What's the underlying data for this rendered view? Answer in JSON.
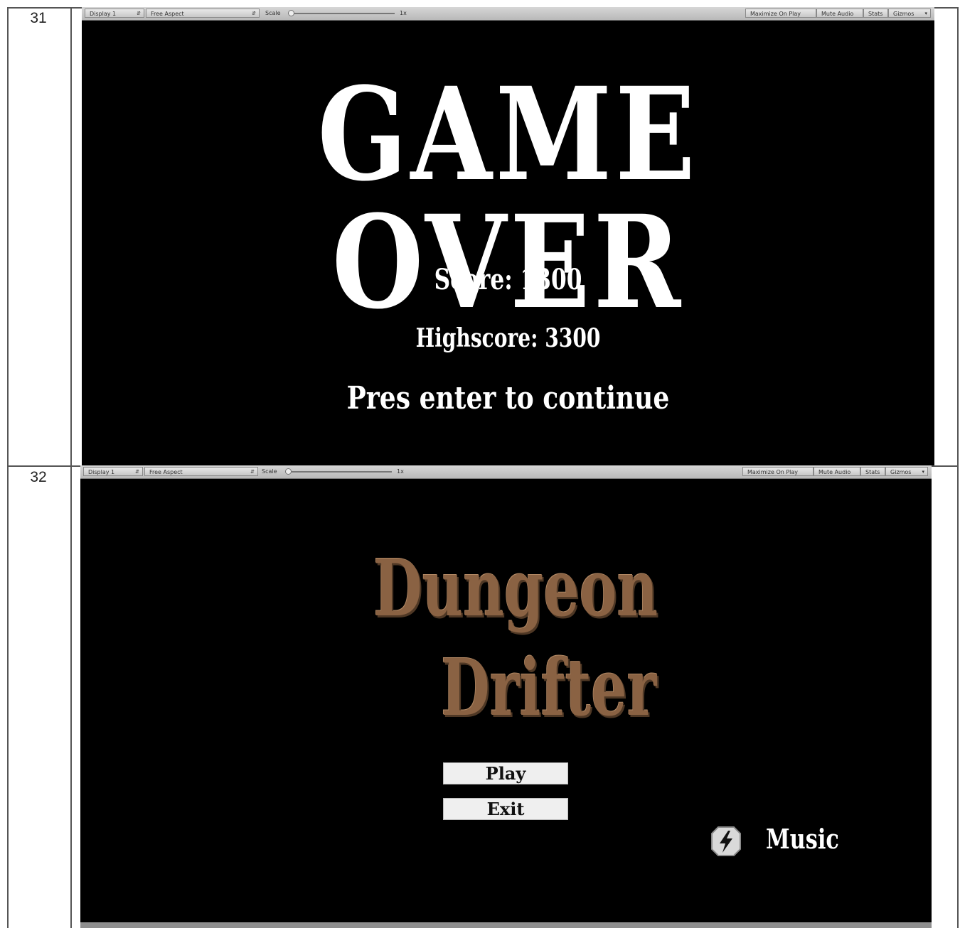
{
  "rows": [
    {
      "number": "31",
      "toolbar": {
        "display": "Display 1",
        "aspect": "Free Aspect",
        "scale_label": "Scale",
        "scale_value": "1x",
        "maximize": "Maximize On Play",
        "mute": "Mute Audio",
        "stats": "Stats",
        "gizmos": "Gizmos"
      },
      "screen": {
        "title": "GAME OVER",
        "score": "Score: 1300",
        "highscore": "Highscore: 3300",
        "prompt": "Pres enter to continue"
      }
    },
    {
      "number": "32",
      "toolbar": {
        "display": "Display 1",
        "aspect": "Free Aspect",
        "scale_label": "Scale",
        "scale_value": "1x",
        "maximize": "Maximize On Play",
        "mute": "Mute Audio",
        "stats": "Stats",
        "gizmos": "Gizmos"
      },
      "screen": {
        "title_line1": "Dungeon",
        "title_line2": "Drifter",
        "play": "Play",
        "exit": "Exit",
        "music": "Music",
        "music_icon": "lightning-bolt-icon"
      }
    }
  ],
  "colors": {
    "game_bg": "#000000",
    "title_brown": "#8a6243",
    "button_bg": "#efefef"
  }
}
